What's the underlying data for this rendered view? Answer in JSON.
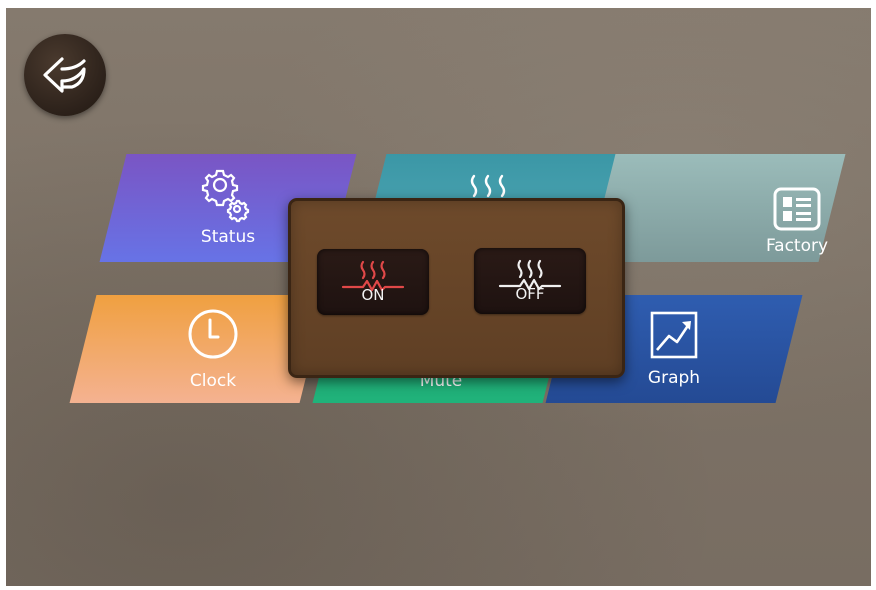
{
  "back_button": {
    "icon": "back-arrow-icon"
  },
  "tiles": {
    "status": {
      "label": "Status",
      "icon": "gears-icon"
    },
    "heating": {
      "label": "",
      "icon": "heat-waves-icon"
    },
    "factory": {
      "label": "Factory",
      "icon": "list-icon"
    },
    "clock": {
      "label": "Clock",
      "icon": "clock-icon"
    },
    "mute": {
      "label": "Mute",
      "icon": ""
    },
    "graph": {
      "label": "Graph",
      "icon": "chart-icon"
    }
  },
  "heater_popup": {
    "on_button": {
      "label": "ON",
      "icon": "heater-on-icon",
      "color": "#e04848"
    },
    "off_button": {
      "label": "OFF",
      "icon": "heater-off-icon",
      "color": "#f0f0f0"
    }
  }
}
